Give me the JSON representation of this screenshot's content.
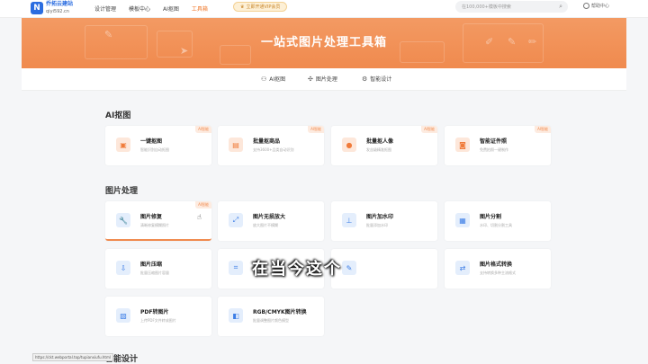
{
  "brand": {
    "mark": "N",
    "name": "乔拓云建站",
    "url": "qiyi592.cn"
  },
  "nav": [
    "设计管理",
    "模板中心",
    "AI抠图",
    "工具箱"
  ],
  "nav_active": 3,
  "vip": {
    "icon": "crown-icon",
    "label": "立即开通VIP会员"
  },
  "search": {
    "placeholder": "在100,000+模板中搜索"
  },
  "help": {
    "label": "帮助中心"
  },
  "banner": {
    "title": "一站式图片处理工具箱",
    "color": "#f08a4e"
  },
  "categories": [
    {
      "icon": "ai-cutout-icon",
      "label": "AI抠图"
    },
    {
      "icon": "image-process-icon",
      "label": "图片处理"
    },
    {
      "icon": "smart-design-icon",
      "label": "智能设计"
    }
  ],
  "sections": [
    {
      "title": "AI抠图",
      "tools": [
        {
          "name": "一键抠图",
          "desc": "智能识别自动抠图",
          "icon": "portrait-icon",
          "tag": "AI智能"
        },
        {
          "name": "批量抠商品",
          "desc": "支持3600+品类自动识别",
          "icon": "shopping-bag-icon",
          "tag": "AI智能"
        },
        {
          "name": "批量抠人像",
          "desc": "发丝级精准抠图",
          "icon": "person-icon",
          "tag": "AI智能"
        },
        {
          "name": "智能证件照",
          "desc": "免费拍照一键制作",
          "icon": "id-photo-icon",
          "tag": "AI智能"
        }
      ]
    },
    {
      "title": "图片处理",
      "tools": [
        {
          "name": "图片修复",
          "desc": "清晰修复模糊照片",
          "icon": "wrench-icon",
          "tag": "AI智能"
        },
        {
          "name": "图片无损放大",
          "desc": "放大图片不模糊",
          "icon": "expand-icon",
          "tag": ""
        },
        {
          "name": "图片加水印",
          "desc": "批量添加水印",
          "icon": "stamp-icon",
          "tag": ""
        },
        {
          "name": "图片分割",
          "desc": "水印、切割分割工具",
          "icon": "grid-icon",
          "tag": ""
        },
        {
          "name": "图片压缩",
          "desc": "批量压缩图片容量",
          "icon": "compress-icon",
          "tag": ""
        },
        {
          "name": "",
          "desc": "",
          "icon": "crop-icon",
          "tag": ""
        },
        {
          "name": "",
          "desc": "",
          "icon": "edit-icon",
          "tag": ""
        },
        {
          "name": "图片格式转换",
          "desc": "支持转换多种主流格式",
          "icon": "convert-icon",
          "tag": ""
        },
        {
          "name": "PDF转图片",
          "desc": "上传PDF文件转成图片",
          "icon": "pdf-icon",
          "tag": ""
        },
        {
          "name": "RGB/CMYK图片转换",
          "desc": "批量调整图片颜色模型",
          "icon": "color-convert-icon",
          "tag": ""
        }
      ]
    },
    {
      "title": "智能设计",
      "tools": []
    }
  ],
  "subtitle": "在当今这个",
  "status_url": "https://ckt.webportal.top/tupianxiufu.html"
}
